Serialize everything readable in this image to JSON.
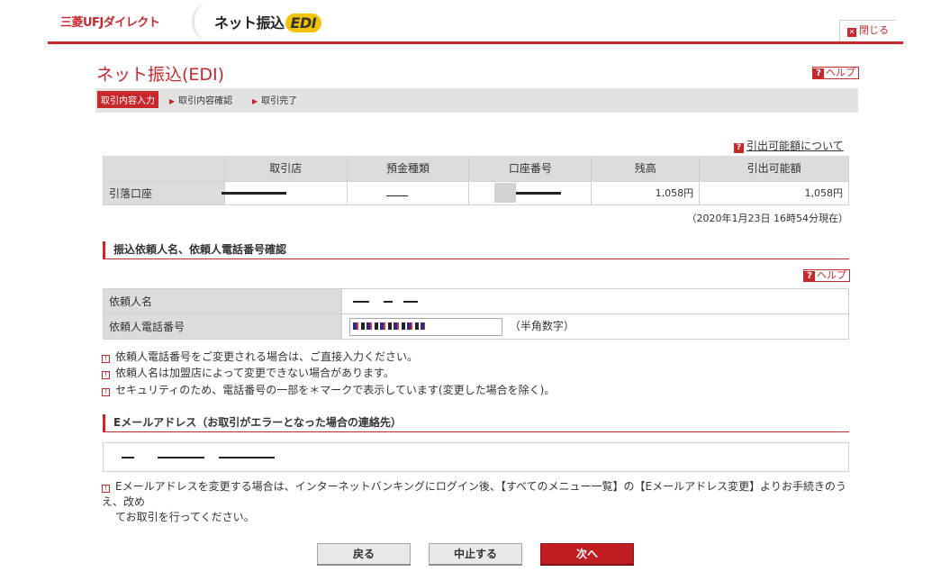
{
  "header": {
    "brand": "三菱UFJダイレクト",
    "product": "ネット振込",
    "product_badge": "EDI",
    "close_label": "閉じる"
  },
  "page": {
    "title": "ネット振込(EDI)",
    "help_label": "ヘルプ"
  },
  "steps": [
    {
      "label": "取引内容入力",
      "active": true
    },
    {
      "label": "取引内容確認",
      "active": false
    },
    {
      "label": "取引完了",
      "active": false
    }
  ],
  "account": {
    "available_link": "引出可能額について",
    "headers": [
      "",
      "取引店",
      "預金種類",
      "口座番号",
      "残高",
      "引出可能額"
    ],
    "row_label": "引落口座",
    "balance": "1,058円",
    "withdrawable": "1,058円",
    "timestamp": "（2020年1月23日 16時54分現在）"
  },
  "requester": {
    "section_title": "振込依頼人名、依頼人電話番号確認",
    "help_label": "ヘルプ",
    "name_label": "依頼人名",
    "phone_label": "依頼人電話番号",
    "phone_hint": "（半角数字）"
  },
  "notes": [
    "依頼人電話番号をご変更される場合は、ご直接入力ください。",
    "依頼人名は加盟店によって変更できない場合があります。",
    "セキュリティのため、電話番号の一部を＊マークで表示しています(変更した場合を除く)。"
  ],
  "email": {
    "section_title": "Eメールアドレス（お取引がエラーとなった場合の連絡先）",
    "note_line1": "Eメールアドレスを変更する場合は、インターネットバンキングにログイン後、【すべてのメニュー一覧】の【Eメールアドレス変更】よりお手続きのうえ、改め",
    "note_line2": "てお取引を行ってください。"
  },
  "buttons": {
    "back": "戻る",
    "cancel": "中止する",
    "next": "次へ"
  },
  "colors": {
    "accent": "#c6282b",
    "header_gray": "#dcdcdc"
  }
}
